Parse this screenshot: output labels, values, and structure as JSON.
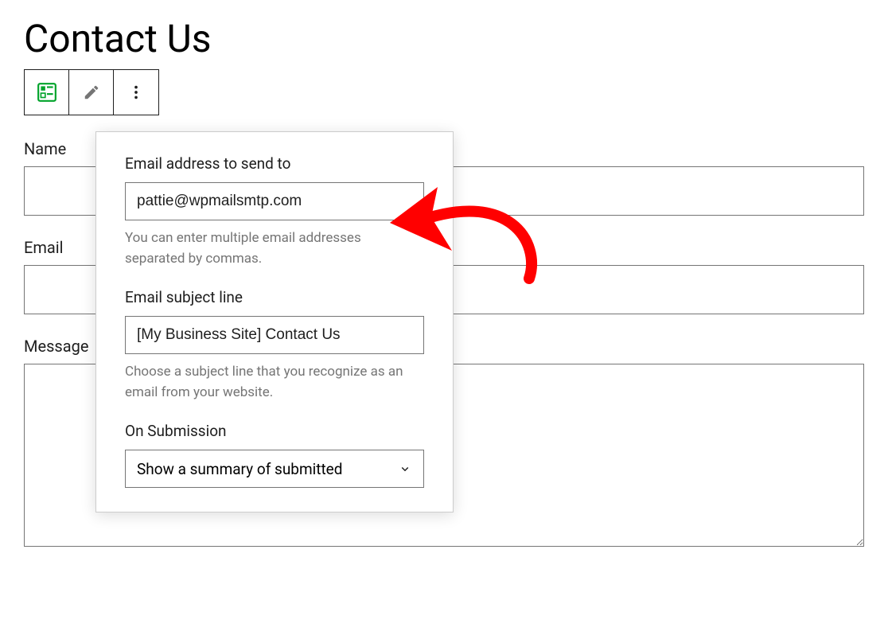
{
  "page_title": "Contact Us",
  "fields": {
    "name": {
      "label": "Name",
      "value": ""
    },
    "email": {
      "label": "Email",
      "value": ""
    },
    "message": {
      "label": "Message",
      "value": ""
    }
  },
  "popover": {
    "email_to": {
      "label": "Email address to send to",
      "value": "pattie@wpmailsmtp.com",
      "help": "You can enter multiple email addresses separated by commas."
    },
    "subject": {
      "label": "Email subject line",
      "value": "[My Business Site] Contact Us",
      "help": "Choose a subject line that you recognize as an email from your website."
    },
    "submission": {
      "label": "On Submission",
      "selected": "Show a summary of submitted"
    }
  }
}
